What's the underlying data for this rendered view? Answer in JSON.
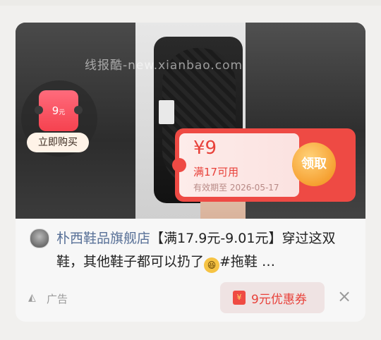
{
  "ad_card": {
    "watermark": "线报酷-new.xianbao.com",
    "mini_coupon": {
      "value": "9",
      "unit": "元",
      "buy_label": "立即购买"
    },
    "coupon": {
      "amount": "¥9",
      "condition": "满17可用",
      "expiry": "有效期至 2026-05-17",
      "claim_label": "领取"
    },
    "store_name": "朴西鞋品旗舰店",
    "description": "【满17.9元-9.01元】穿过这双鞋，其他鞋子都可以扔了",
    "emoji": "😆",
    "hashtag": "#拖鞋 …",
    "ad_label": "广告",
    "coupon_button": "9元优惠券",
    "close_icon": "×"
  },
  "colors": {
    "accent": "#ee4a44",
    "claim": "#f6a132",
    "store_link": "#587097"
  }
}
